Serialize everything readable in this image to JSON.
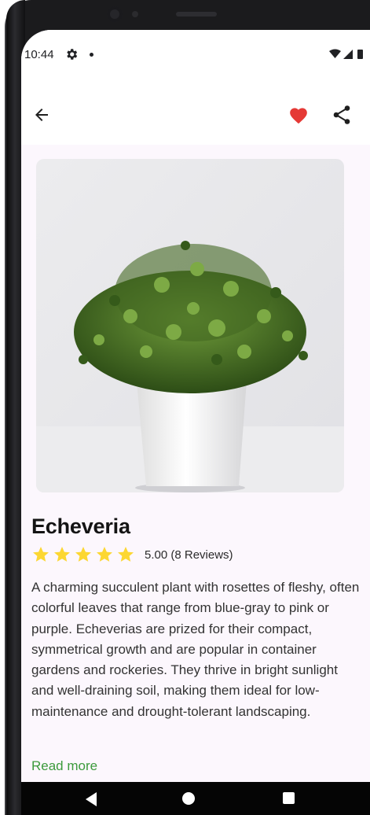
{
  "status_bar": {
    "time": "10:44",
    "icons": [
      "gear-icon",
      "notification-dot-icon",
      "wifi-icon",
      "signal-icon",
      "battery-icon"
    ]
  },
  "app_bar": {
    "icons": [
      "back-arrow-icon",
      "heart-icon",
      "share-icon"
    ],
    "favorite_color": "#e53935"
  },
  "plant": {
    "name": "Echeveria",
    "rating": 5,
    "rating_text": "5.00 (8 Reviews)",
    "star_color": "#fcd732",
    "description": "A charming succulent plant with rosettes of fleshy, often colorful leaves that range from blue-gray to pink or purple. Echeverias are prized for their compact, symmetrical growth and are popular in container gardens and rockeries. They thrive in bright sunlight and well-draining soil, making them ideal for low-maintenance and drought-tolerant landscaping.",
    "read_more_label": "Read more",
    "read_more_color": "#3c9a3c"
  },
  "nav_bar": {
    "icons": [
      "nav-back-icon",
      "nav-home-icon",
      "nav-recents-icon"
    ]
  }
}
